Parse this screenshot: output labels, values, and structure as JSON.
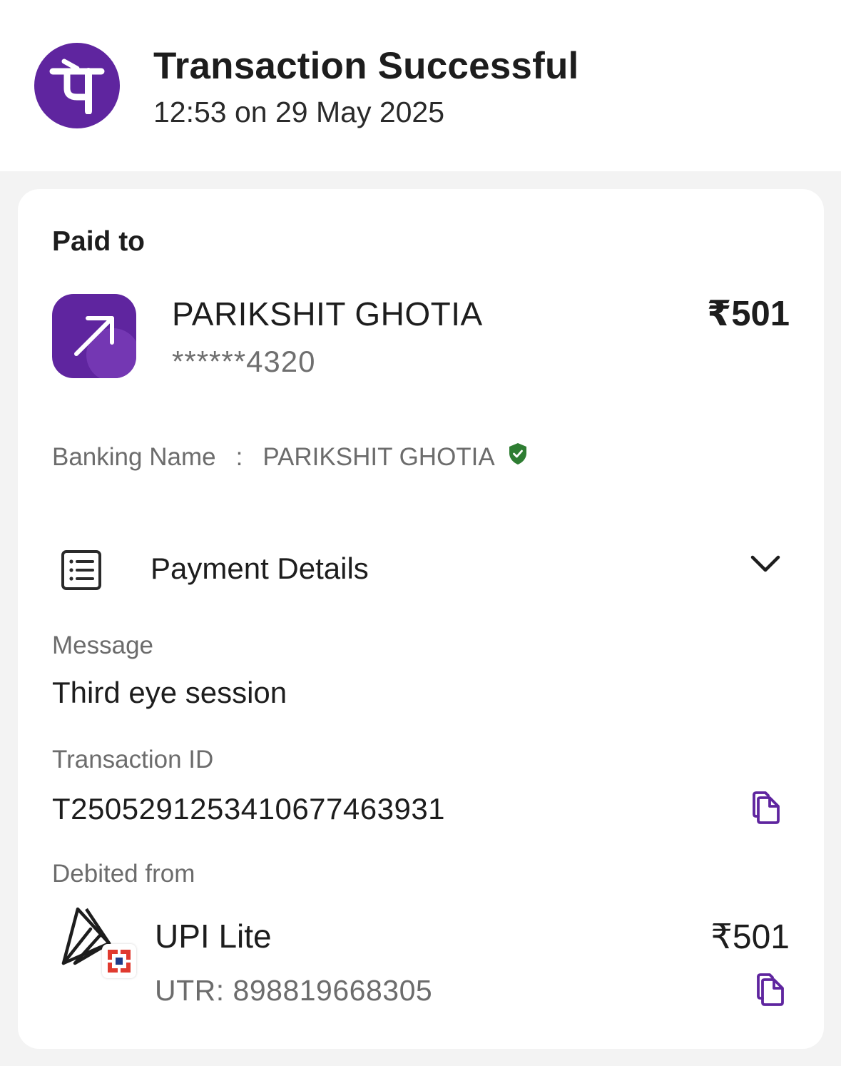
{
  "header": {
    "title": "Transaction Successful",
    "subtitle": "12:53 on 29 May 2025",
    "logo_icon": "phonepe-logo",
    "brand_color": "#5f259f"
  },
  "paid_to": {
    "section_label": "Paid to",
    "payee_icon": "arrow-up-right-icon",
    "payee_name": "PARIKSHIT GHOTIA",
    "payee_account": "******4320",
    "amount": "₹501"
  },
  "banking": {
    "label": "Banking Name",
    "separator": ":",
    "name": "PARIKSHIT GHOTIA",
    "verified_icon": "verified-shield-icon",
    "verified_color": "#2e7d32"
  },
  "payment_details": {
    "label": "Payment Details",
    "icon": "receipt-list-icon",
    "toggle_icon": "chevron-down-icon"
  },
  "message": {
    "label": "Message",
    "value": "Third eye session"
  },
  "transaction": {
    "label": "Transaction ID",
    "value": "T2505291253410677463931",
    "copy_icon": "copy-icon"
  },
  "debited": {
    "label": "Debited from",
    "method": "UPI Lite",
    "utr": "UTR: 898819668305",
    "amount": "₹501",
    "method_icon": "upi-lite-logo",
    "bank_icon": "bank-badge-icon",
    "copy_icon": "copy-icon"
  }
}
